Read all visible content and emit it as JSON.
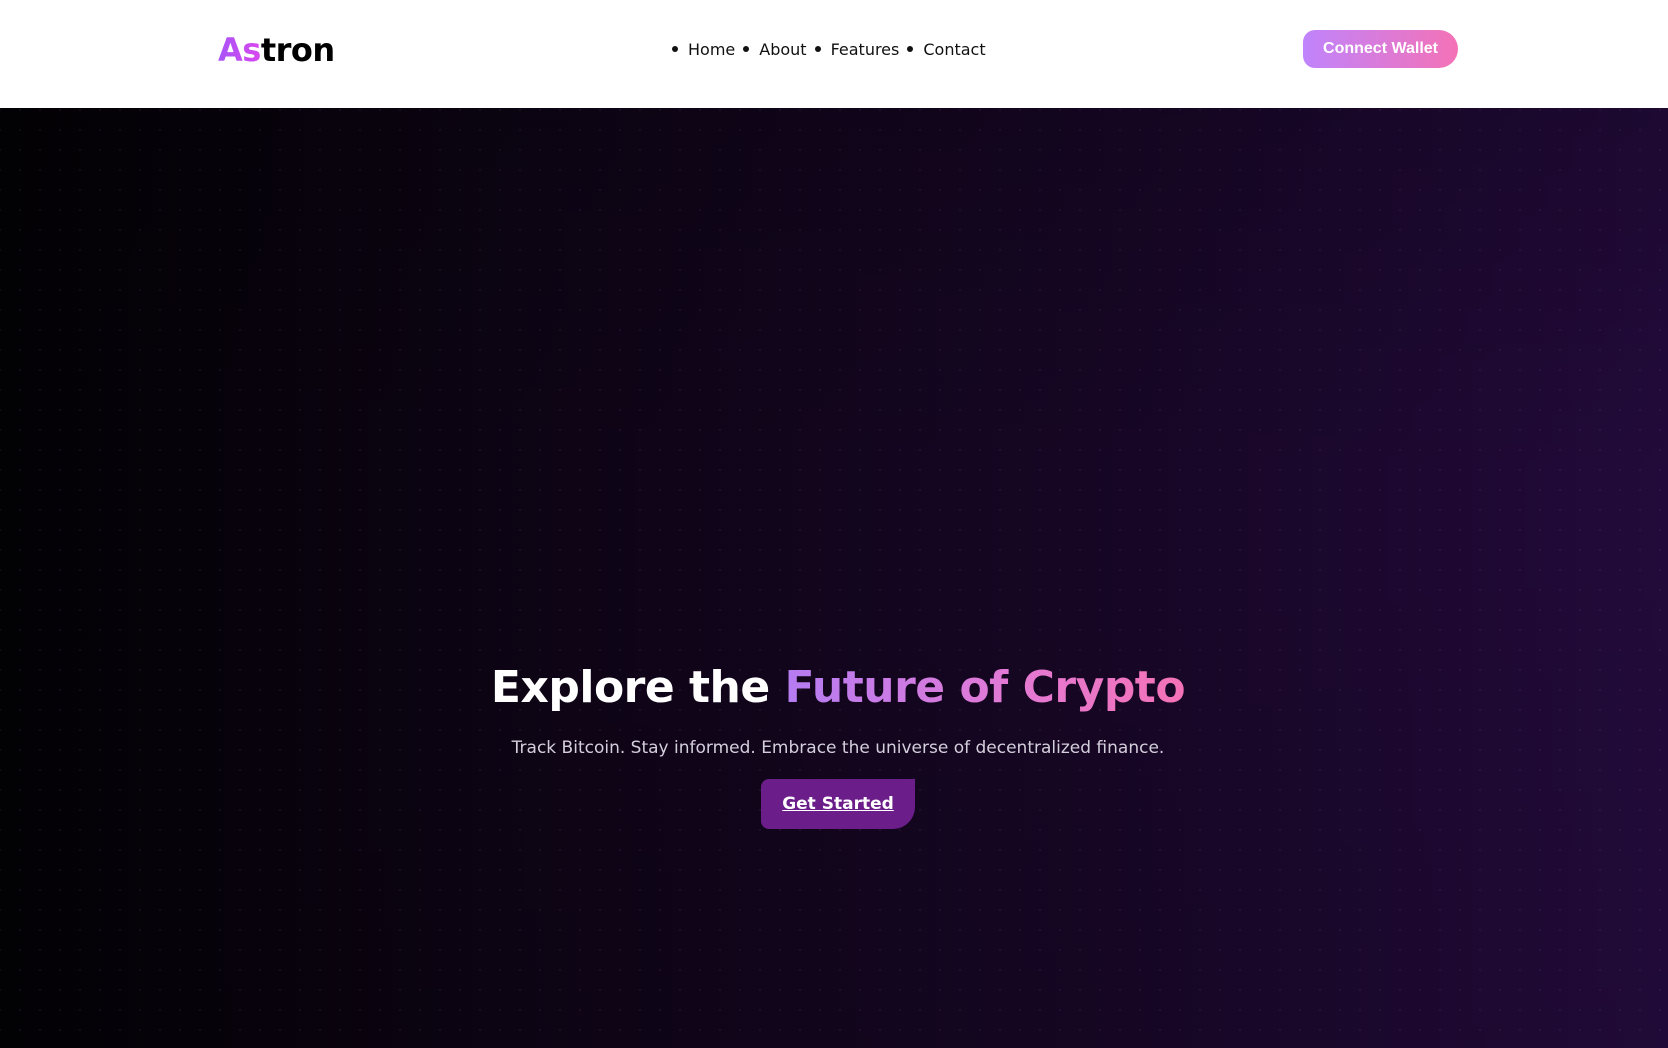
{
  "header": {
    "logo": {
      "accent": "As",
      "rest": "tron"
    },
    "nav": [
      {
        "label": "Home"
      },
      {
        "label": "About"
      },
      {
        "label": "Features"
      },
      {
        "label": "Contact"
      }
    ],
    "connect_wallet_label": "Connect Wallet"
  },
  "hero": {
    "title_plain": "Explore the ",
    "title_highlight": "Future of Crypto",
    "subtitle": "Track Bitcoin. Stay informed. Embrace the universe of decentralized finance.",
    "cta_label": "Get Started"
  },
  "colors": {
    "brand_gradient_start": "#c084fc",
    "brand_gradient_end": "#f472b6",
    "cta_background": "#6b1d8a",
    "hero_background_dark": "#020104",
    "hero_background_purple": "#220a3a"
  }
}
